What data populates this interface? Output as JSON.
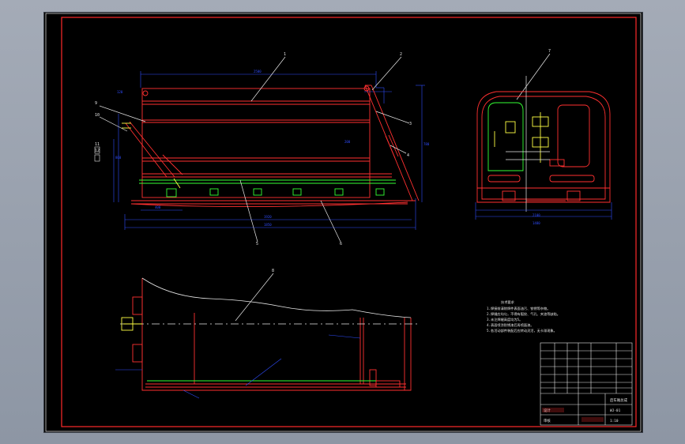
{
  "colors": {
    "background": "#9aa2af",
    "sheet": "#000000",
    "frame": "#ff2a2a",
    "outline": "#ff3030",
    "dimension": "#2f4dff",
    "leader": "#e8e8e8",
    "green_part": "#33ff33",
    "yellow_mark": "#ffff44",
    "cyan_mark": "#33ffff"
  },
  "balloons": [
    "1",
    "2",
    "3",
    "4",
    "5",
    "6",
    "7",
    "8",
    "9",
    "10",
    "11",
    "12"
  ],
  "notes": {
    "title": "技术要求",
    "lines": [
      "1.焊接前清除焊件表面油污、铁锈等杂物。",
      "2.焊缝应均匀，不得有裂纹、气孔、夹渣等缺陷。",
      "3.未注焊缝高度均为5。",
      "4.表面喷涂防锈漆后再喷面漆。",
      "5.各活动部件装配后应转动灵活，无卡滞现象。"
    ]
  },
  "title_block": {
    "title": "后车厢总成",
    "drawing_no": "WJ-01",
    "scale": "1:10",
    "designer": "设计",
    "checker": "审核"
  },
  "dimensions": [
    "2500",
    "1920",
    "1850",
    "2100",
    "1480",
    "860",
    "780",
    "400",
    "120",
    "200"
  ]
}
